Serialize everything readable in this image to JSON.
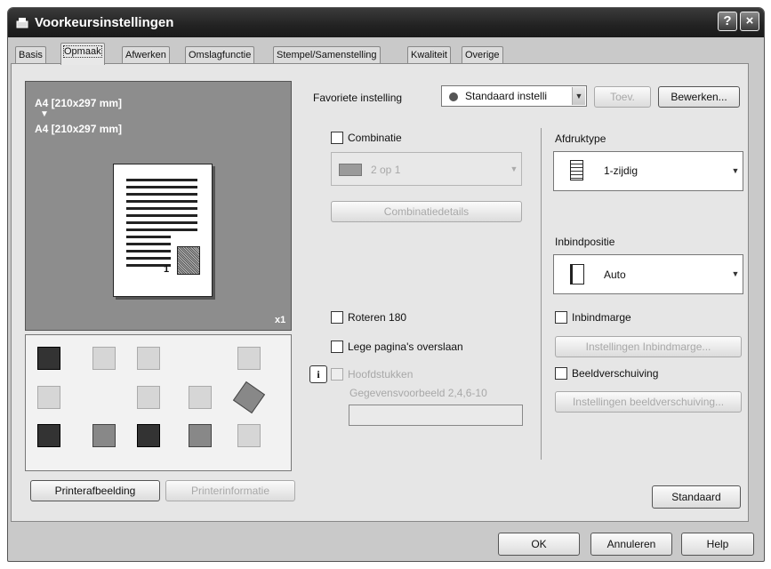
{
  "window": {
    "title": "Voorkeursinstellingen",
    "help_button": "?",
    "close_button": "×"
  },
  "tabs": [
    {
      "label": "Basis",
      "active": false
    },
    {
      "label": "Opmaak",
      "active": true
    },
    {
      "label": "Afwerken",
      "active": false
    },
    {
      "label": "Omslagfunctie",
      "active": false
    },
    {
      "label": "Stempel/Samenstelling",
      "active": false
    },
    {
      "label": "Kwaliteit",
      "active": false
    },
    {
      "label": "Overige",
      "active": false
    }
  ],
  "preview": {
    "line1": "A4 [210x297 mm]",
    "arrow": "▼",
    "line2": "A4 [210x297 mm]",
    "copies": "x1",
    "page_number": "1"
  },
  "left_buttons": {
    "printer_view": "Printerafbeelding",
    "printer_info": "Printerinformatie"
  },
  "favorite": {
    "label": "Favoriete instelling",
    "value": "Standaard instelli",
    "add": "Toev.",
    "edit": "Bewerken..."
  },
  "combination": {
    "label": "Combinatie",
    "checked": false,
    "value": "2 op 1",
    "details_button": "Combinatiedetails"
  },
  "rotate": {
    "label": "Roteren 180",
    "checked": false
  },
  "skip_blank": {
    "label": "Lege pagina's overslaan",
    "checked": false
  },
  "chapters": {
    "label": "Hoofdstukken",
    "checked": false,
    "example_label": "Gegevensvoorbeeld 2,4,6-10",
    "value": ""
  },
  "print_type": {
    "label": "Afdruktype",
    "value": "1-zijdig"
  },
  "binding_position": {
    "label": "Inbindpositie",
    "value": "Auto"
  },
  "binding_margin": {
    "label": "Inbindmarge",
    "checked": false,
    "settings_button": "Instellingen Inbindmarge..."
  },
  "image_shift": {
    "label": "Beeldverschuiving",
    "checked": false,
    "settings_button": "Instellingen beeldverschuiving..."
  },
  "default_button": "Standaard",
  "footer": {
    "ok": "OK",
    "cancel": "Annuleren",
    "help": "Help"
  }
}
